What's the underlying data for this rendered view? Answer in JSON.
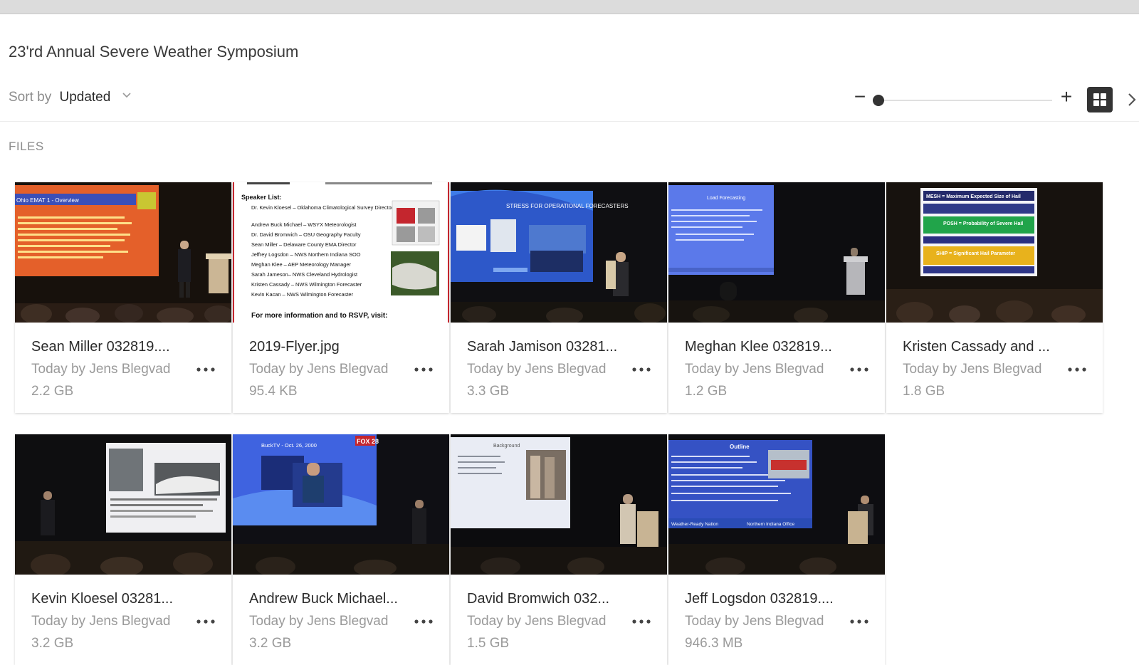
{
  "album": {
    "title": "23'rd Annual Severe Weather Symposium"
  },
  "toolbar": {
    "sort_label": "Sort by",
    "sort_value": "Updated",
    "zoom_minus": "−",
    "zoom_plus": "+",
    "zoom_level_fraction": 0.0
  },
  "section": {
    "label": "FILES"
  },
  "colors": {
    "title_text": "#3a3a3a",
    "muted_text": "#9a9a9a",
    "dark_control": "#333333"
  },
  "files": [
    {
      "name": "Sean Miller 032819....",
      "meta": "Today by Jens Blegvad",
      "size": "2.2 GB"
    },
    {
      "name": "2019-Flyer.jpg",
      "meta": "Today by Jens Blegvad",
      "size": "95.4 KB"
    },
    {
      "name": "Sarah Jamison 03281...",
      "meta": "Today by Jens Blegvad",
      "size": "3.3 GB"
    },
    {
      "name": "Meghan Klee 032819...",
      "meta": "Today by Jens Blegvad",
      "size": "1.2 GB"
    },
    {
      "name": "Kristen Cassady and ...",
      "meta": "Today by Jens Blegvad",
      "size": "1.8 GB"
    },
    {
      "name": "Kevin Kloesel 03281...",
      "meta": "Today by Jens Blegvad",
      "size": "3.2 GB"
    },
    {
      "name": "Andrew Buck Michael...",
      "meta": "Today by Jens Blegvad",
      "size": "3.2 GB"
    },
    {
      "name": "David Bromwich 032...",
      "meta": "Today by Jens Blegvad",
      "size": "1.5 GB"
    },
    {
      "name": "Jeff Logsdon 032819....",
      "meta": "Today by Jens Blegvad",
      "size": "946.3 MB"
    }
  ],
  "flyer": {
    "speaker_list_heading": "Speaker List:",
    "speakers": [
      "Dr. Kevin Kloesel – Oklahoma Climatological Survey Director",
      "Andrew Buck Michael – WSYX Meteorologist",
      "Dr. David Bromwich – OSU Geography Faculty",
      "Sean Miller – Delaware County EMA Director",
      "Jeffrey Logsdon – NWS Northern Indiana SOO",
      "Meghan Klee – AEP Meteorology Manager",
      "Sarah Jameson– NWS Cleveland Hydrologist",
      "Kristen Cassady – NWS Wilmington Forecaster",
      "Kevin Kacan – NWS Wilmington Forecaster"
    ],
    "footer": "For more information and to RSVP, visit:"
  },
  "slides": {
    "s1_title": "Ohio EMAT 1 - Overview",
    "s3_title": "STRESS FOR OPERATIONAL FORECASTERS",
    "s4_title": "Load Forecasting",
    "s5_mesh": "MESH = Maximum Expected Size of Hail",
    "s5_posh": "POSH = Probability of Severe Hail",
    "s5_ship": "SHIP = Significant Hail Parameter",
    "s7_title": "BuckTV - Oct. 26, 2000",
    "s7_logo": "FOX 28",
    "s8_title": "Background",
    "s9_title": "Outline",
    "s9_footer_left": "Weather-Ready Nation",
    "s9_footer_right": "Northern Indiana Office"
  }
}
